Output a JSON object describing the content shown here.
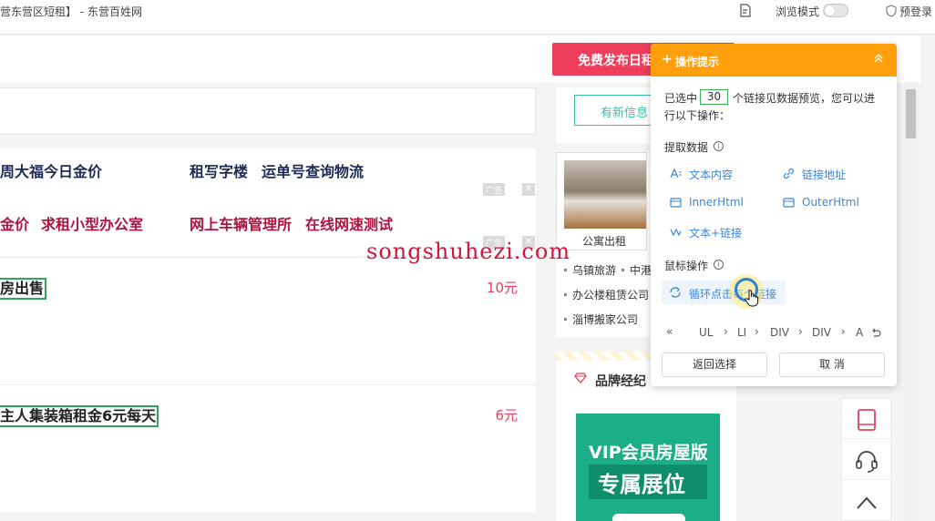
{
  "browser": {
    "tab_title": "营东营区短租】 - 东营百姓网",
    "browse_mode_label": "浏览模式",
    "login_label": "预登录"
  },
  "header": {
    "publish_button": "免费发布日租"
  },
  "hotlinks": {
    "row1": [
      "周大福今日金价",
      "租写字楼",
      "运单号查询物流"
    ],
    "row2": [
      "金价",
      "求租小型办公室",
      "网上车辆管理所",
      "在线网速测试"
    ],
    "ad_label": "广告"
  },
  "listings": [
    {
      "title": "房出售",
      "price": "10元"
    },
    {
      "title": "主人集装箱租金6元每天",
      "price": "6元"
    }
  ],
  "sidebar": {
    "new_info_button": "有新信息",
    "photo_caption": "公寓出租",
    "links": [
      {
        "left": "乌镇旅游",
        "right": "中港"
      },
      {
        "left": "办公楼租赁公司"
      },
      {
        "left": "淄博搬家公司"
      }
    ],
    "brand_title": "品牌经纪",
    "vip_title": "VIP会员房屋版",
    "vip_subtitle": "专属展位"
  },
  "watermark": "songshuhezi.com",
  "op_panel": {
    "title": "操作提示",
    "selected_prefix": "已选中",
    "selected_count": "30",
    "selected_suffix": "个链接见数据预览，您可以进",
    "selected_line2": "行以下操作：",
    "extract_title": "提取数据",
    "extract_actions": [
      "文本内容",
      "链接地址",
      "InnerHtml",
      "OuterHtml",
      "文本+链接"
    ],
    "mouse_title": "鼠标操作",
    "loop_label": "循环点击每个链接",
    "breadcrumb": [
      "UL",
      "LI",
      "DIV",
      "DIV",
      "A"
    ],
    "back_button": "返回选择",
    "cancel_button": "取 消"
  },
  "colors": {
    "accent_orange": "#ff9f0c",
    "publish_red": "#ee3e5b",
    "link_blue": "#3f85d3",
    "vip_green": "#1cae86",
    "highlight_green": "#2ea55a"
  }
}
